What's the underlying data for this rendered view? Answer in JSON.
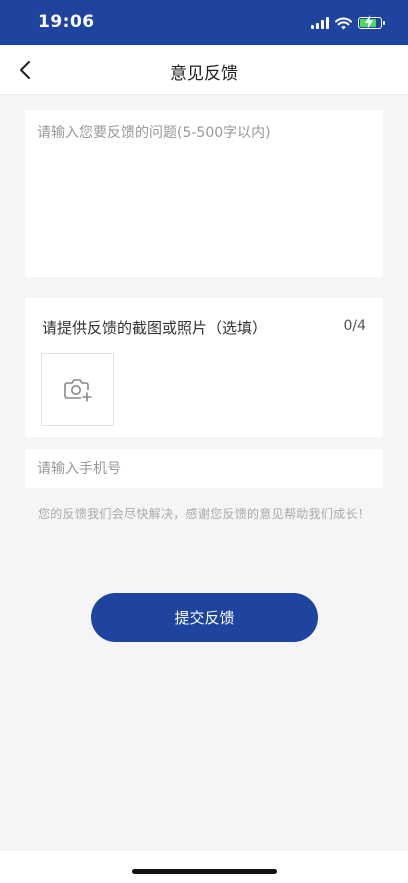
{
  "status_bar": {
    "time": "19:06",
    "battery_level": 0.8,
    "icons": [
      "signal-icon",
      "wifi-icon",
      "battery-charging-icon"
    ]
  },
  "nav": {
    "title": "意见反馈",
    "back_icon": "chevron-left-icon"
  },
  "feedback": {
    "placeholder": "请输入您要反馈的问题(5-500字以内)",
    "value": ""
  },
  "photo_upload": {
    "label": "请提供反馈的截图或照片（选填）",
    "count": "0/4",
    "upload_icon": "camera-add-icon"
  },
  "phone": {
    "placeholder": "请输入手机号",
    "value": ""
  },
  "hint": "您的反馈我们会尽快解决，感谢您反馈的意见帮助我们成长！",
  "submit_label": "提交反馈",
  "colors": {
    "primary": "#1e44a0",
    "background": "#f5f5f5",
    "card": "#ffffff",
    "placeholder": "#999999",
    "hint": "#aaaaaa"
  }
}
